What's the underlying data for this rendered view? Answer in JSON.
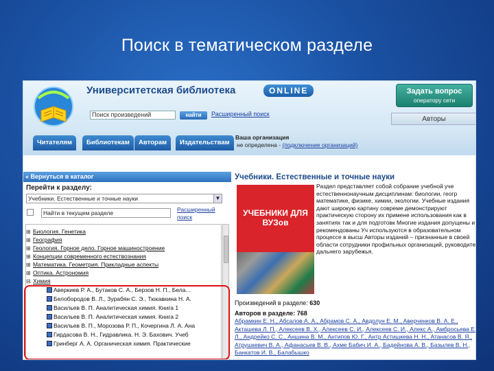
{
  "slide": {
    "title": "Поиск в тематическом разделе"
  },
  "header": {
    "library_title": "Университетская библиотека",
    "online_badge": "ONLINE",
    "search_value": "Поиск произведений",
    "search_button": "найти",
    "advanced_search": "Расширенный поиск",
    "ask_title": "Задать вопрос",
    "ask_sub": "оператору сети",
    "authors_tab": "Авторы"
  },
  "nav": {
    "tabs": [
      "Читателям",
      "Библиотекам",
      "Авторам",
      "Издательствам"
    ],
    "org_label": "Ваша организация",
    "org_value_prefix": "не определена - ",
    "org_link": "(подключение организаций)"
  },
  "left_panel": {
    "back_link": "« Вернуться в каталог",
    "goto_label": "Перейти к разделу:",
    "selected_section": "Учебники. Естественные и точные науки",
    "section_search_value": "Найти в текущем разделе",
    "advanced_small": "Расширенный поиск",
    "tree_items": [
      {
        "pm": "⊞",
        "label": "Биология. Генетика"
      },
      {
        "pm": "⊞",
        "label": "География"
      },
      {
        "pm": "⊞",
        "label": "Геология. Горное дело. Горное машиностроение"
      },
      {
        "pm": "⊞",
        "label": "Концепции современного естествознания"
      },
      {
        "pm": "⊞",
        "label": "Математика. Геометрия. Прикладные аспекты"
      },
      {
        "pm": "⊞",
        "label": "Оптика. Астрономия"
      },
      {
        "pm": "⊟",
        "label": "Химия"
      }
    ],
    "books": [
      "Аверкиев Р. А., Бутаков С. А., Берзов Н. П., Бела...",
      "Белобородов В. Л., Зурабян С. Э., Тюкавкина Н. А.",
      "Васильев В. П. Аналитическая химия. Книга 1",
      "Васильев В. П. Аналитическая химия. Книга 2",
      "Васильев В. П., Морозова Р. П., Кочергина Л. А. Ана",
      "Гирдасова В. Н., Гидравлика. Н. Э. Бахович. Учеб",
      "Гринберг А. А. Органическая химия. Практические"
    ]
  },
  "right_panel": {
    "section_title": "Учебники. Естественные и точные науки",
    "cover_text": "УЧЕБНИКИ ДЛЯ ВУЗов",
    "description": "Раздел представляет собой собрание учебной уче естественнонаучным дисциплинам: биологии, геогр математике, физике, химии, экологии. Учебные издания дают широкую картину совреме демонстрируют практическую сторону их примене использования как в занятиях так и для подготовк Многие издания допущены и рекомендованы Уч используются в образовательном процессе в высш Авторы изданий – признанные в своей области сотрудники профильных организаций, руководите дальнего зарубежья.",
    "count_label": "Произведений в разделе:",
    "count_value": "630",
    "authors_label": "Авторов в разделе:",
    "authors_value": "768",
    "authors_list": "Абрамкин Е. Н., Абсалов А. А., Абрамов С. А., Авдолун Е. М., Аверченков В. А. Е., Акташева Л. П., Алексеев В. Х., Алексеев С. И., Алексеев С. И., Алекс А., Амбросьева Е. Л., Андрейко С. С., Аншина В. М., Антипов Ю. Г., Антр Астишкева Н. Н., Атанасов В. Я., Атрушкевич В. А., Афанасьев В. В., Ахме Бабич И. А., Бадейнова А. В., Базылев В. Н., Банкатов И. В., Балабышко"
  }
}
